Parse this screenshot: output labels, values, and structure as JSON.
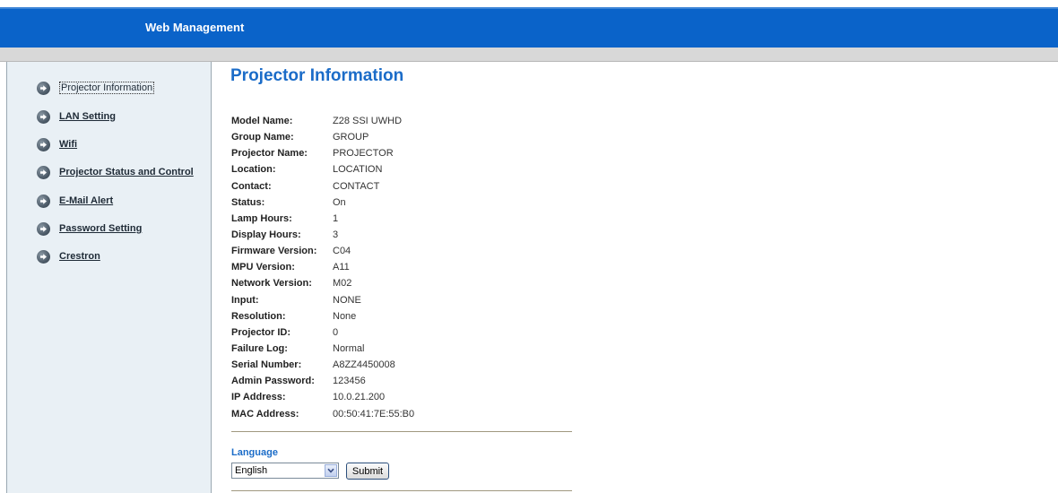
{
  "header": {
    "title": "Web Management"
  },
  "colors": {
    "header_blue": "#0a63c9",
    "sidebar_bg": "#e9f0f5",
    "title_blue": "#1b6cc8"
  },
  "sidebar": {
    "items": [
      {
        "label": "Projector Information",
        "icon": "arrow-right-circle-icon",
        "active": true
      },
      {
        "label": "LAN Setting",
        "icon": "arrow-right-circle-icon",
        "active": false
      },
      {
        "label": "Wifi",
        "icon": "arrow-right-circle-icon",
        "active": false
      },
      {
        "label": "Projector Status and Control",
        "icon": "arrow-right-circle-icon",
        "active": false
      },
      {
        "label": "E-Mail Alert",
        "icon": "arrow-right-circle-icon",
        "active": false
      },
      {
        "label": "Password Setting",
        "icon": "arrow-right-circle-icon",
        "active": false
      },
      {
        "label": "Crestron",
        "icon": "arrow-right-circle-icon",
        "active": false
      }
    ]
  },
  "main": {
    "title": "Projector Information",
    "info": [
      {
        "label": "Model Name:",
        "value": "Z28 SSI UWHD"
      },
      {
        "label": "Group Name:",
        "value": "GROUP"
      },
      {
        "label": "Projector Name:",
        "value": "PROJECTOR"
      },
      {
        "label": "Location:",
        "value": "LOCATION"
      },
      {
        "label": "Contact:",
        "value": "CONTACT"
      },
      {
        "label": "Status:",
        "value": "On"
      },
      {
        "label": "Lamp Hours:",
        "value": "1"
      },
      {
        "label": "Display Hours:",
        "value": "3"
      },
      {
        "label": "Firmware Version:",
        "value": "C04"
      },
      {
        "label": "MPU Version:",
        "value": "A11"
      },
      {
        "label": "Network Version:",
        "value": "M02"
      },
      {
        "label": "Input:",
        "value": "NONE"
      },
      {
        "label": "Resolution:",
        "value": "None"
      },
      {
        "label": "Projector ID:",
        "value": "0"
      },
      {
        "label": "Failure Log:",
        "value": "Normal"
      },
      {
        "label": "Serial Number:",
        "value": "A8ZZ4450008"
      },
      {
        "label": "Admin Password:",
        "value": "123456"
      },
      {
        "label": "IP Address:",
        "value": "10.0.21.200"
      },
      {
        "label": "MAC Address:",
        "value": "00:50:41:7E:55:B0"
      }
    ],
    "language": {
      "label": "Language",
      "selected": "English",
      "submit_label": "Submit"
    }
  }
}
